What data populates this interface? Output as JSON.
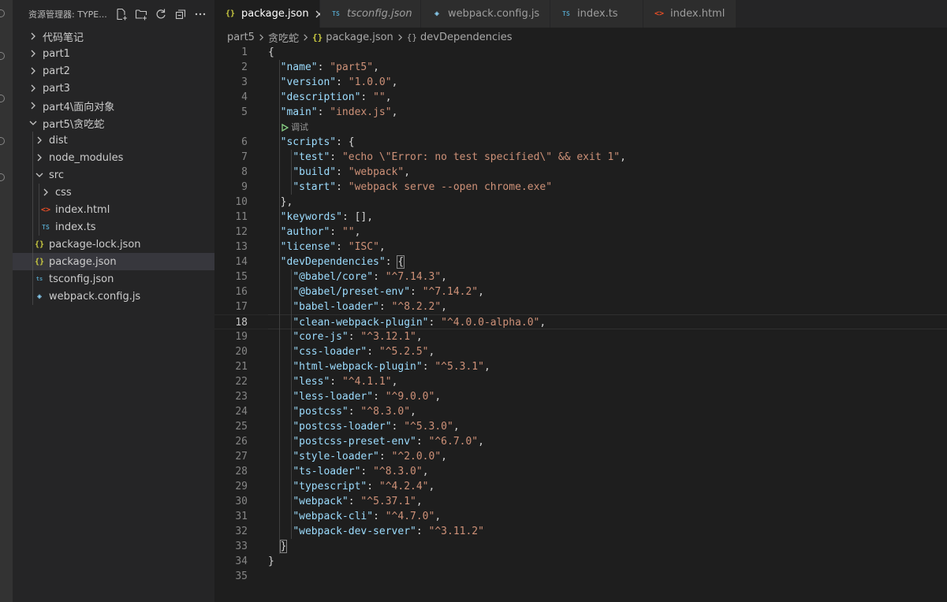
{
  "sidebar": {
    "title": "资源管理器: TYPE...",
    "tree": [
      {
        "label": "代码笔记",
        "type": "folder",
        "expanded": false,
        "depth": 0
      },
      {
        "label": "part1",
        "type": "folder",
        "expanded": false,
        "depth": 0
      },
      {
        "label": "part2",
        "type": "folder",
        "expanded": false,
        "depth": 0
      },
      {
        "label": "part3",
        "type": "folder",
        "expanded": false,
        "depth": 0
      },
      {
        "label": "part4\\面向对象",
        "type": "folder",
        "expanded": false,
        "depth": 0
      },
      {
        "label": "part5\\贪吃蛇",
        "type": "folder",
        "expanded": true,
        "depth": 0
      },
      {
        "label": "dist",
        "type": "folder",
        "expanded": false,
        "depth": 1
      },
      {
        "label": "node_modules",
        "type": "folder",
        "expanded": false,
        "depth": 1
      },
      {
        "label": "src",
        "type": "folder",
        "expanded": true,
        "depth": 1
      },
      {
        "label": "css",
        "type": "folder",
        "expanded": false,
        "depth": 2
      },
      {
        "label": "index.html",
        "type": "html",
        "depth": 2
      },
      {
        "label": "index.ts",
        "type": "ts",
        "depth": 2
      },
      {
        "label": "package-lock.json",
        "type": "json",
        "depth": 1
      },
      {
        "label": "package.json",
        "type": "json",
        "depth": 1,
        "selected": true
      },
      {
        "label": "tsconfig.json",
        "type": "tsconf",
        "depth": 1
      },
      {
        "label": "webpack.config.js",
        "type": "webpack",
        "depth": 1
      }
    ]
  },
  "tabs": [
    {
      "label": "package.json",
      "icon": "{}",
      "active": true,
      "italic": false
    },
    {
      "label": "tsconfig.json",
      "icon": "TS",
      "active": false,
      "italic": true
    },
    {
      "label": "webpack.config.js",
      "icon": "cube",
      "active": false,
      "italic": false
    },
    {
      "label": "index.ts",
      "icon": "TS",
      "active": false,
      "italic": false
    },
    {
      "label": "index.html",
      "icon": "<>",
      "active": false,
      "italic": false
    }
  ],
  "breadcrumb": {
    "folder": "part5",
    "subfolder": "贪吃蛇",
    "file": "package.json",
    "symbol": "devDependencies",
    "file_icon": "{}",
    "symbol_icon": "{}"
  },
  "editor": {
    "current_line": 18,
    "codelens_after_line": 5,
    "codelens_label": "调试",
    "lines": [
      [
        [
          "p",
          "{"
        ]
      ],
      [
        [
          "p",
          "  "
        ],
        [
          "k",
          "\"name\""
        ],
        [
          "p",
          ": "
        ],
        [
          "s",
          "\"part5\""
        ],
        [
          "p",
          ","
        ]
      ],
      [
        [
          "p",
          "  "
        ],
        [
          "k",
          "\"version\""
        ],
        [
          "p",
          ": "
        ],
        [
          "s",
          "\"1.0.0\""
        ],
        [
          "p",
          ","
        ]
      ],
      [
        [
          "p",
          "  "
        ],
        [
          "k",
          "\"description\""
        ],
        [
          "p",
          ": "
        ],
        [
          "s",
          "\"\""
        ],
        [
          "p",
          ","
        ]
      ],
      [
        [
          "p",
          "  "
        ],
        [
          "k",
          "\"main\""
        ],
        [
          "p",
          ": "
        ],
        [
          "s",
          "\"index.js\""
        ],
        [
          "p",
          ","
        ]
      ],
      [
        [
          "p",
          "  "
        ],
        [
          "k",
          "\"scripts\""
        ],
        [
          "p",
          ": {"
        ]
      ],
      [
        [
          "p",
          "    "
        ],
        [
          "k",
          "\"test\""
        ],
        [
          "p",
          ": "
        ],
        [
          "s",
          "\"echo \\\"Error: no test specified\\\" && exit 1\""
        ],
        [
          "p",
          ","
        ]
      ],
      [
        [
          "p",
          "    "
        ],
        [
          "k",
          "\"build\""
        ],
        [
          "p",
          ": "
        ],
        [
          "s",
          "\"webpack\""
        ],
        [
          "p",
          ","
        ]
      ],
      [
        [
          "p",
          "    "
        ],
        [
          "k",
          "\"start\""
        ],
        [
          "p",
          ": "
        ],
        [
          "s",
          "\"webpack serve --open chrome.exe\""
        ]
      ],
      [
        [
          "p",
          "  },"
        ]
      ],
      [
        [
          "p",
          "  "
        ],
        [
          "k",
          "\"keywords\""
        ],
        [
          "p",
          ": [],"
        ]
      ],
      [
        [
          "p",
          "  "
        ],
        [
          "k",
          "\"author\""
        ],
        [
          "p",
          ": "
        ],
        [
          "s",
          "\"\""
        ],
        [
          "p",
          ","
        ]
      ],
      [
        [
          "p",
          "  "
        ],
        [
          "k",
          "\"license\""
        ],
        [
          "p",
          ": "
        ],
        [
          "s",
          "\"ISC\""
        ],
        [
          "p",
          ","
        ]
      ],
      [
        [
          "p",
          "  "
        ],
        [
          "k",
          "\"devDependencies\""
        ],
        [
          "p",
          ": "
        ],
        [
          "bm",
          "{"
        ]
      ],
      [
        [
          "p",
          "    "
        ],
        [
          "k",
          "\"@babel/core\""
        ],
        [
          "p",
          ": "
        ],
        [
          "s",
          "\"^7.14.3\""
        ],
        [
          "p",
          ","
        ]
      ],
      [
        [
          "p",
          "    "
        ],
        [
          "k",
          "\"@babel/preset-env\""
        ],
        [
          "p",
          ": "
        ],
        [
          "s",
          "\"^7.14.2\""
        ],
        [
          "p",
          ","
        ]
      ],
      [
        [
          "p",
          "    "
        ],
        [
          "k",
          "\"babel-loader\""
        ],
        [
          "p",
          ": "
        ],
        [
          "s",
          "\"^8.2.2\""
        ],
        [
          "p",
          ","
        ]
      ],
      [
        [
          "p",
          "    "
        ],
        [
          "k",
          "\"clean-webpack-plugin\""
        ],
        [
          "p",
          ": "
        ],
        [
          "s",
          "\"^4.0.0-alpha.0\""
        ],
        [
          "p",
          ","
        ]
      ],
      [
        [
          "p",
          "    "
        ],
        [
          "k",
          "\"core-js\""
        ],
        [
          "p",
          ": "
        ],
        [
          "s",
          "\"^3.12.1\""
        ],
        [
          "p",
          ","
        ]
      ],
      [
        [
          "p",
          "    "
        ],
        [
          "k",
          "\"css-loader\""
        ],
        [
          "p",
          ": "
        ],
        [
          "s",
          "\"^5.2.5\""
        ],
        [
          "p",
          ","
        ]
      ],
      [
        [
          "p",
          "    "
        ],
        [
          "k",
          "\"html-webpack-plugin\""
        ],
        [
          "p",
          ": "
        ],
        [
          "s",
          "\"^5.3.1\""
        ],
        [
          "p",
          ","
        ]
      ],
      [
        [
          "p",
          "    "
        ],
        [
          "k",
          "\"less\""
        ],
        [
          "p",
          ": "
        ],
        [
          "s",
          "\"^4.1.1\""
        ],
        [
          "p",
          ","
        ]
      ],
      [
        [
          "p",
          "    "
        ],
        [
          "k",
          "\"less-loader\""
        ],
        [
          "p",
          ": "
        ],
        [
          "s",
          "\"^9.0.0\""
        ],
        [
          "p",
          ","
        ]
      ],
      [
        [
          "p",
          "    "
        ],
        [
          "k",
          "\"postcss\""
        ],
        [
          "p",
          ": "
        ],
        [
          "s",
          "\"^8.3.0\""
        ],
        [
          "p",
          ","
        ]
      ],
      [
        [
          "p",
          "    "
        ],
        [
          "k",
          "\"postcss-loader\""
        ],
        [
          "p",
          ": "
        ],
        [
          "s",
          "\"^5.3.0\""
        ],
        [
          "p",
          ","
        ]
      ],
      [
        [
          "p",
          "    "
        ],
        [
          "k",
          "\"postcss-preset-env\""
        ],
        [
          "p",
          ": "
        ],
        [
          "s",
          "\"^6.7.0\""
        ],
        [
          "p",
          ","
        ]
      ],
      [
        [
          "p",
          "    "
        ],
        [
          "k",
          "\"style-loader\""
        ],
        [
          "p",
          ": "
        ],
        [
          "s",
          "\"^2.0.0\""
        ],
        [
          "p",
          ","
        ]
      ],
      [
        [
          "p",
          "    "
        ],
        [
          "k",
          "\"ts-loader\""
        ],
        [
          "p",
          ": "
        ],
        [
          "s",
          "\"^8.3.0\""
        ],
        [
          "p",
          ","
        ]
      ],
      [
        [
          "p",
          "    "
        ],
        [
          "k",
          "\"typescript\""
        ],
        [
          "p",
          ": "
        ],
        [
          "s",
          "\"^4.2.4\""
        ],
        [
          "p",
          ","
        ]
      ],
      [
        [
          "p",
          "    "
        ],
        [
          "k",
          "\"webpack\""
        ],
        [
          "p",
          ": "
        ],
        [
          "s",
          "\"^5.37.1\""
        ],
        [
          "p",
          ","
        ]
      ],
      [
        [
          "p",
          "    "
        ],
        [
          "k",
          "\"webpack-cli\""
        ],
        [
          "p",
          ": "
        ],
        [
          "s",
          "\"^4.7.0\""
        ],
        [
          "p",
          ","
        ]
      ],
      [
        [
          "p",
          "    "
        ],
        [
          "k",
          "\"webpack-dev-server\""
        ],
        [
          "p",
          ": "
        ],
        [
          "s",
          "\"^3.11.2\""
        ]
      ],
      [
        [
          "p",
          "  "
        ],
        [
          "bm",
          "}"
        ]
      ],
      [
        [
          "p",
          "}"
        ]
      ],
      []
    ]
  }
}
